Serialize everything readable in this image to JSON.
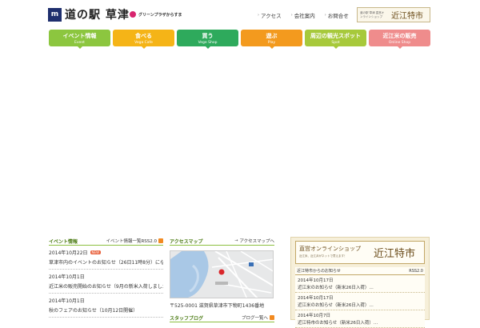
{
  "header": {
    "logo_mark": "m",
    "logo_text": "道の駅 草津",
    "partner_text": "グリーンプラザからすま",
    "topnav": [
      {
        "label": "アクセス"
      },
      {
        "label": "会社案内"
      },
      {
        "label": "お問合せ"
      }
    ],
    "shop_badge_small": "道の駅 草津 直営オンラインショップ",
    "shop_badge_big": "近江特市"
  },
  "mainnav": [
    {
      "jp": "イベント情報",
      "en": "Event",
      "color": "#8cc63f"
    },
    {
      "jp": "食べる",
      "en": "Vega Cafe",
      "color": "#f5b417"
    },
    {
      "jp": "買う",
      "en": "Vege Shop",
      "color": "#2eaa5c"
    },
    {
      "jp": "遊ぶ",
      "en": "Play",
      "color": "#f39a1e"
    },
    {
      "jp": "周辺の観光スポット",
      "en": "Spot",
      "color": "#a7c93b"
    },
    {
      "jp": "近江米の販売",
      "en": "Online Shop",
      "color": "#ef8c8c"
    }
  ],
  "events": {
    "title": "イベント情報",
    "link": "イベント情報一覧RSS2.0",
    "items": [
      {
        "date": "2014年10月22日",
        "badge": "NEW",
        "text": "草津市内のイベントのお知らせ（26日11時8分）になります"
      },
      {
        "date": "2014年10月1日",
        "badge": "",
        "text": "近江米の販売開始のお知らせ（9月の新米入荷しました）10月19日〜開催"
      },
      {
        "date": "2014年10月1日",
        "badge": "",
        "text": "秋のフェアのお知らせ（10月12日開催）"
      }
    ]
  },
  "access": {
    "title": "アクセスマップ",
    "link": "アクセスマップへ",
    "address": "〒525-0001 滋賀県草津市下物町1436番地",
    "map_label": "道の駅草津",
    "staff_title": "スタッフブログ",
    "staff_link": "ブログ一覧へ"
  },
  "shop": {
    "banner_left": "直営オンラインショップ",
    "banner_sub": "近江米、近江弁がネットで買えます！",
    "banner_right": "近江特市",
    "news_title": "近江特市からのお知らせ",
    "news_rss": "RSS2.0",
    "items": [
      {
        "date": "2014年10月17日",
        "text": "近江米のお知らせ（新米26日入荷）…"
      },
      {
        "date": "2014年10月17日",
        "text": "近江米のお知らせ（新米26日入荷）…"
      },
      {
        "date": "2014年10月7日",
        "text": "近江特市のお知らせ（新米26日入荷）…"
      }
    ]
  }
}
